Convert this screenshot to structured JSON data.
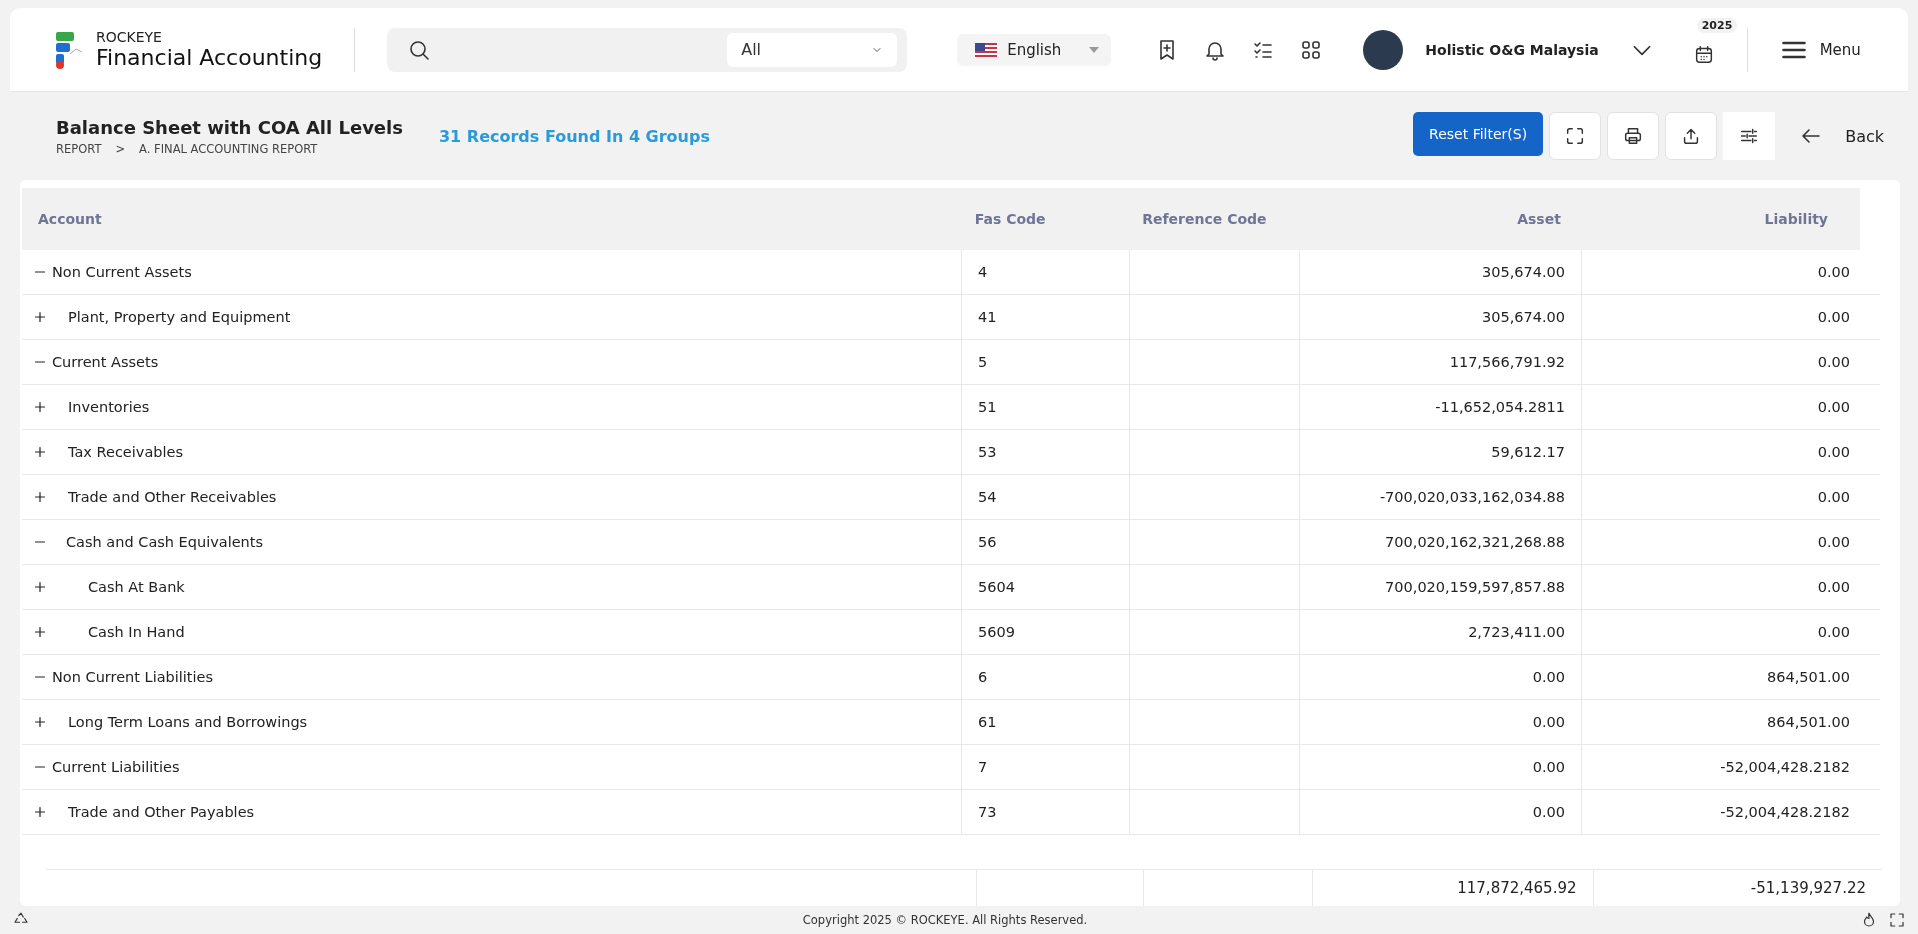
{
  "app": {
    "brand": "ROCKEYE",
    "product": "Financial Accounting"
  },
  "search": {
    "scope": "All"
  },
  "language": "English",
  "user": {
    "name": "Holistic O&G Malaysia"
  },
  "year": "2025",
  "menu_label": "Menu",
  "page": {
    "title": "Balance Sheet with COA All Levels",
    "breadcrumb": [
      "REPORT",
      ">",
      "A. FINAL ACCOUNTING REPORT"
    ],
    "records": "31 Records Found In 4 Groups"
  },
  "toolbar": {
    "reset": "Reset Filter(S)",
    "back": "Back"
  },
  "table": {
    "columns": [
      "Account",
      "Fas Code",
      "Reference Code",
      "Asset",
      "Liability"
    ],
    "rows": [
      {
        "expanded": true,
        "account": "Non Current Assets",
        "fas_code": "4",
        "asset": "305,674.00",
        "liability": "0.00",
        "children": [
          {
            "expanded": false,
            "account": "Plant, Property and Equipment",
            "fas_code": "41",
            "asset": "305,674.00",
            "liability": "0.00"
          }
        ]
      },
      {
        "expanded": true,
        "account": "Current Assets",
        "fas_code": "5",
        "asset": "117,566,791.92",
        "liability": "0.00",
        "children": [
          {
            "expanded": false,
            "account": "Inventories",
            "fas_code": "51",
            "asset": "-11,652,054.2811",
            "liability": "0.00"
          },
          {
            "expanded": false,
            "account": "Tax Receivables",
            "fas_code": "53",
            "asset": "59,612.17",
            "liability": "0.00"
          },
          {
            "expanded": false,
            "account": "Trade and Other Receivables",
            "fas_code": "54",
            "asset": "-700,020,033,162,034.88",
            "liability": "0.00"
          },
          {
            "expanded": true,
            "account": "Cash and Cash Equivalents",
            "fas_code": "56",
            "asset": "700,020,162,321,268.88",
            "liability": "0.00",
            "children": [
              {
                "expanded": false,
                "account": "Cash At Bank",
                "fas_code": "5604",
                "asset": "700,020,159,597,857.88",
                "liability": "0.00"
              },
              {
                "expanded": false,
                "account": "Cash In Hand",
                "fas_code": "5609",
                "asset": "2,723,411.00",
                "liability": "0.00"
              }
            ]
          }
        ]
      },
      {
        "expanded": true,
        "account": "Non Current Liabilities",
        "fas_code": "6",
        "asset": "0.00",
        "liability": "864,501.00",
        "children": [
          {
            "expanded": false,
            "account": "Long Term Loans and Borrowings",
            "fas_code": "61",
            "asset": "0.00",
            "liability": "864,501.00"
          }
        ]
      },
      {
        "expanded": true,
        "account": "Current Liabilities",
        "fas_code": "7",
        "asset": "0.00",
        "liability": "-52,004,428.2182",
        "children": [
          {
            "expanded": false,
            "account": "Trade and Other Payables",
            "fas_code": "73",
            "asset": "0.00",
            "liability": "-52,004,428.2182"
          }
        ]
      }
    ],
    "totals": {
      "asset": "117,872,465.92",
      "liability": "-51,139,927.22"
    }
  },
  "footer": "Copyright 2025 © ROCKEYE. All Rights Reserved."
}
